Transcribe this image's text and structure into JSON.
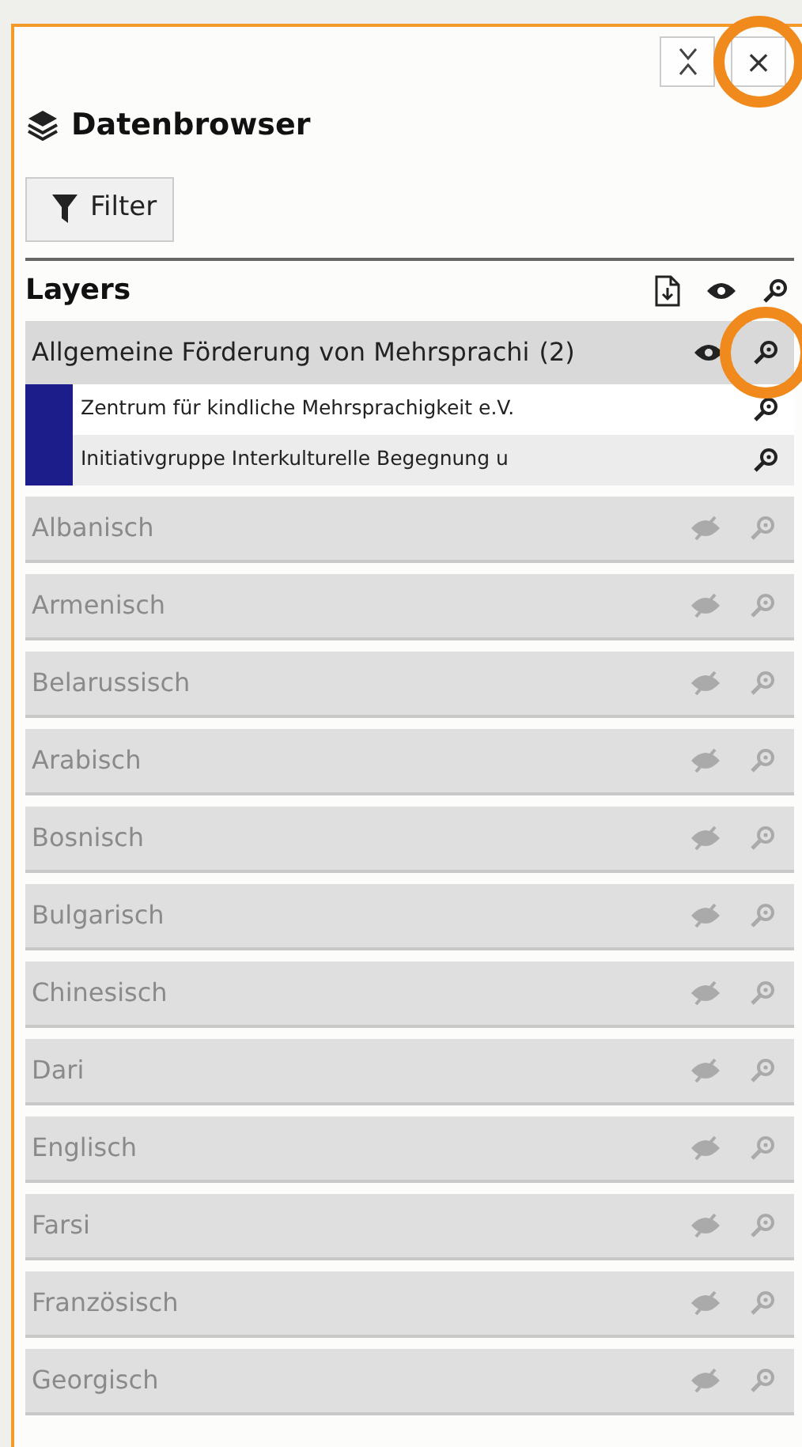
{
  "panel": {
    "title": "Datenbrowser",
    "close_button": {
      "label": "×",
      "highlighted": true
    }
  },
  "filter_button": {
    "label": "Filter"
  },
  "layers_header": {
    "title": "Layers"
  },
  "groups": [
    {
      "kind": "group",
      "label": "Allgemeine Förderung von Mehrsprachi",
      "count": "(2)",
      "visible": true,
      "zoom_highlighted": true,
      "children": [
        {
          "label": "Zentrum für kindliche Mehrsprachigkeit e.V.",
          "color": "#1c1c8a"
        },
        {
          "label": "Initiativgruppe Interkulturelle Begegnung u",
          "color": "#1c1c8a"
        }
      ]
    },
    {
      "kind": "layer",
      "label": "Albanisch",
      "visible": false
    },
    {
      "kind": "layer",
      "label": "Armenisch",
      "visible": false
    },
    {
      "kind": "layer",
      "label": "Belarussisch",
      "visible": false
    },
    {
      "kind": "layer",
      "label": "Arabisch",
      "visible": false
    },
    {
      "kind": "layer",
      "label": "Bosnisch",
      "visible": false
    },
    {
      "kind": "layer",
      "label": "Bulgarisch",
      "visible": false
    },
    {
      "kind": "layer",
      "label": "Chinesisch",
      "visible": false
    },
    {
      "kind": "layer",
      "label": "Dari",
      "visible": false
    },
    {
      "kind": "layer",
      "label": "Englisch",
      "visible": false
    },
    {
      "kind": "layer",
      "label": "Farsi",
      "visible": false
    },
    {
      "kind": "layer",
      "label": "Französisch",
      "visible": false
    },
    {
      "kind": "layer",
      "label": "Georgisch",
      "visible": false
    }
  ]
}
